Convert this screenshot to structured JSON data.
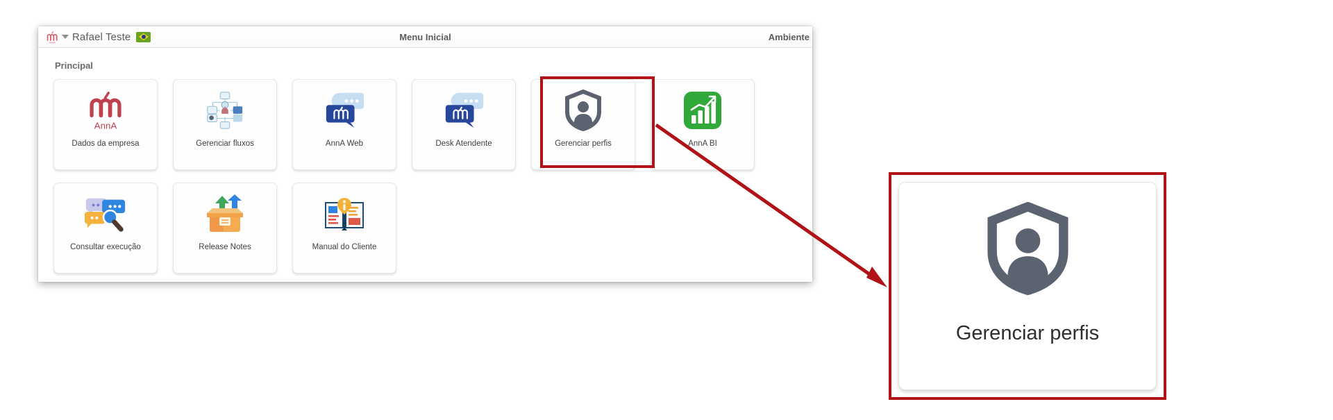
{
  "window": {
    "header": {
      "logo_icon": "anna-logo-icon",
      "dropdown_icon": "chevron-down-icon",
      "user_name": "Rafael Teste",
      "flag_icon": "brazil-flag-icon",
      "title": "Menu Inicial",
      "right_label": "Ambiente"
    },
    "section_title": "Principal"
  },
  "tiles": [
    [
      {
        "label": "Dados da empresa",
        "icon": "anna-logo-icon"
      },
      {
        "label": "Gerenciar fluxos",
        "icon": "flow-diagram-icon"
      },
      {
        "label": "AnnA Web",
        "icon": "chat-bubble-anna-icon"
      },
      {
        "label": "Desk Atendente",
        "icon": "chat-bubble-anna-icon"
      },
      {
        "label": "Gerenciar perfis",
        "icon": "shield-user-icon"
      },
      {
        "label": "AnnA BI",
        "icon": "bar-chart-icon"
      }
    ],
    [
      {
        "label": "Consultar execução",
        "icon": "chat-search-icon"
      },
      {
        "label": "Release Notes",
        "icon": "package-arrows-icon"
      },
      {
        "label": "Manual do Cliente",
        "icon": "open-book-info-icon"
      }
    ]
  ],
  "annotation": {
    "highlight_color": "#b01217",
    "arrow_color": "#b01217",
    "callout": {
      "label": "Gerenciar perfis",
      "icon": "shield-user-icon"
    }
  }
}
